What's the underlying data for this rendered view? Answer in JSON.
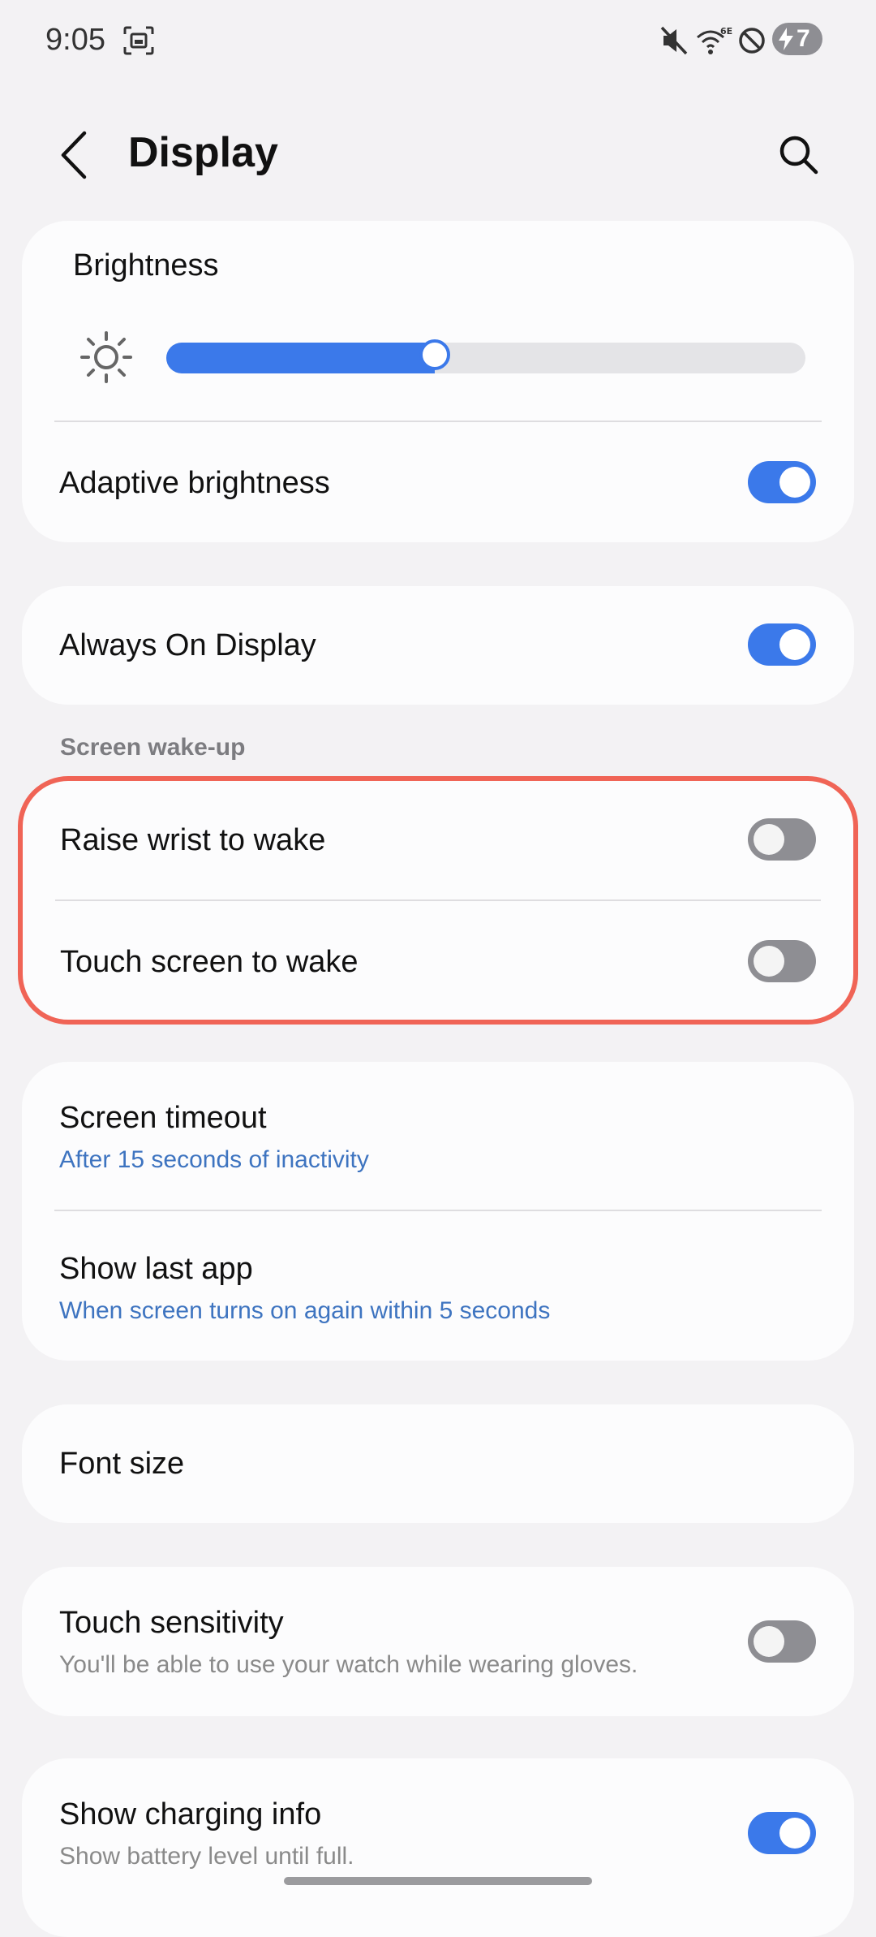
{
  "status_bar": {
    "time": "9:05",
    "battery_level": "7",
    "icons": [
      "screenshot-icon",
      "mute-icon",
      "wifi-6e-icon",
      "do-not-disturb-icon",
      "battery-charging-icon"
    ]
  },
  "header": {
    "title": "Display"
  },
  "brightness": {
    "label": "Brightness",
    "level_percent": 42
  },
  "adaptive_brightness": {
    "label": "Adaptive brightness",
    "on": true
  },
  "always_on_display": {
    "label": "Always On Display",
    "on": true
  },
  "screen_wakeup": {
    "section_label": "Screen wake-up",
    "raise_wrist": {
      "label": "Raise wrist to wake",
      "on": false
    },
    "touch_screen": {
      "label": "Touch screen to wake",
      "on": false
    }
  },
  "screen_timeout": {
    "label": "Screen timeout",
    "value": "After 15 seconds of inactivity"
  },
  "show_last_app": {
    "label": "Show last app",
    "value": "When screen turns on again within 5 seconds"
  },
  "font_size": {
    "label": "Font size"
  },
  "touch_sensitivity": {
    "label": "Touch sensitivity",
    "description": "You'll be able to use your watch while wearing gloves.",
    "on": false
  },
  "show_charging_info": {
    "label": "Show charging info",
    "description": "Show battery level until full.",
    "on": true
  },
  "colors": {
    "accent": "#3b79ea",
    "highlight": "#f06456",
    "link": "#3e74c0"
  }
}
